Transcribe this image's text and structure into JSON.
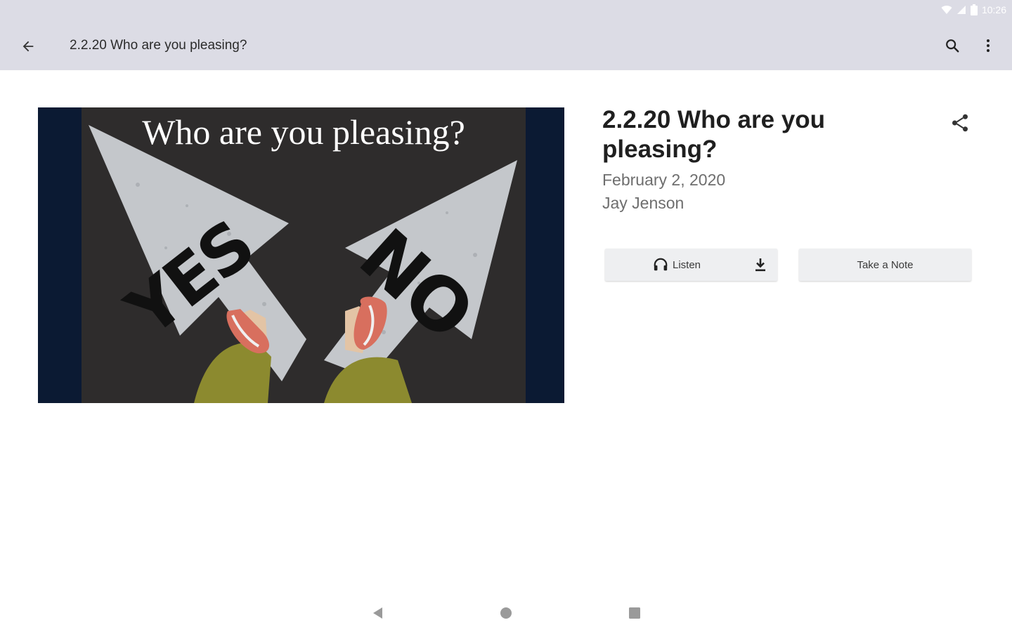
{
  "status_bar": {
    "time": "10:26",
    "icons": [
      "wifi-icon",
      "signal-icon",
      "battery-icon"
    ]
  },
  "app_bar": {
    "title": "2.2.20 Who are you pleasing?",
    "icons": [
      "back-arrow-icon",
      "search-icon",
      "more-vert-icon"
    ]
  },
  "artwork": {
    "caption": "Who are you pleasing?",
    "left_arrow_text": "YES",
    "right_arrow_text": "NO"
  },
  "sermon": {
    "title": "2.2.20 Who are you pleasing?",
    "date": "February 2, 2020",
    "speaker": "Jay Jenson"
  },
  "actions": {
    "listen_label": "Listen",
    "note_label": "Take a Note",
    "icons": [
      "headphones-icon",
      "download-icon",
      "share-icon"
    ]
  },
  "nav_bar": {
    "icons": [
      "nav-back-icon",
      "nav-home-icon",
      "nav-recents-icon"
    ]
  },
  "colors": {
    "app_bar_bg": "#dcdce5",
    "artwork_border": "#0b1a33",
    "button_bg": "#eeeff1"
  }
}
